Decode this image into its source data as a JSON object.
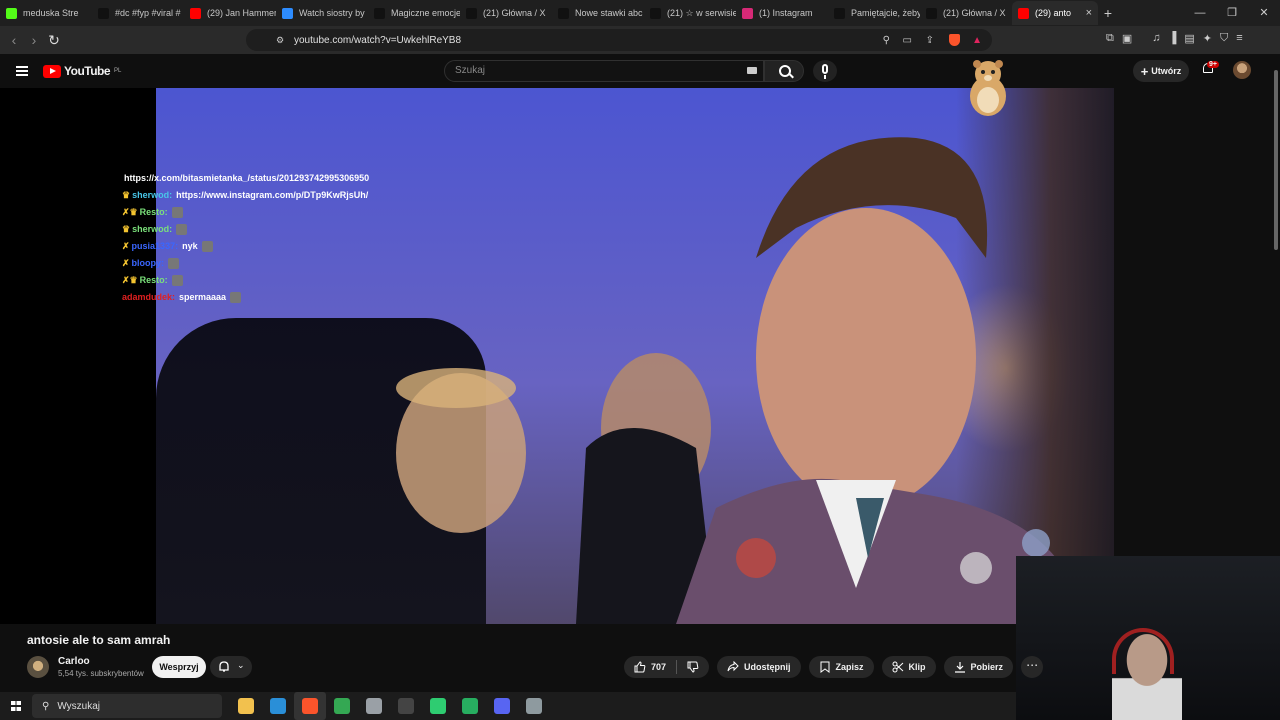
{
  "browser": {
    "tabs": [
      {
        "label": "meduska Stre",
        "icon": "kick-icon",
        "color": "#53fc18"
      },
      {
        "label": "#dc #fyp #viral #",
        "icon": "tiktok-icon",
        "color": "#111111"
      },
      {
        "label": "(29) Jan Hammer",
        "icon": "youtube-icon",
        "color": "#ff0000"
      },
      {
        "label": "Watch siostry by",
        "icon": "watch-icon",
        "color": "#2d8cff"
      },
      {
        "label": "Magiczne emocje",
        "icon": "tiktok-icon",
        "color": "#111111"
      },
      {
        "label": "(21) Główna / X",
        "icon": "x-icon",
        "color": "#111111"
      },
      {
        "label": "Nowe stawki abc",
        "icon": "tiktok-icon",
        "color": "#111111"
      },
      {
        "label": "(21) ☆ w serwisie",
        "icon": "x-icon",
        "color": "#111111"
      },
      {
        "label": "(1) Instagram",
        "icon": "instagram-icon",
        "color": "#d62976"
      },
      {
        "label": "Pamiętajcie, żeby",
        "icon": "tiktok-icon",
        "color": "#111111"
      },
      {
        "label": "(21) Główna / X",
        "icon": "x-icon",
        "color": "#111111"
      },
      {
        "label": "(29) anto",
        "icon": "youtube-icon",
        "color": "#ff0000",
        "active": true
      }
    ],
    "url": "youtube.com/watch?v=UwkehlReYB8"
  },
  "youtube": {
    "logo": "YouTube",
    "region": "PL",
    "search_placeholder": "Szukaj",
    "create_label": "Utwórz",
    "notifications": "9+"
  },
  "chat": [
    {
      "prefix": "",
      "name": "https://x.com/bitasmietanka_/status/201293742995306950",
      "name_color": "white",
      "msg": ""
    },
    {
      "prefix": "♛",
      "name": "sherwod:",
      "name_color": "cyan",
      "msg": "https://www.instagram.com/p/DTp9KwRjsUh/"
    },
    {
      "prefix": "✗♛",
      "name": "Resto:",
      "name_color": "green",
      "msg": ""
    },
    {
      "prefix": "♛",
      "name": "sherwod:",
      "name_color": "green",
      "msg": ""
    },
    {
      "prefix": "✗",
      "name": "pusia1337:",
      "name_color": "blue",
      "msg": "nyk"
    },
    {
      "prefix": "✗",
      "name": "bloopy:",
      "name_color": "blue",
      "msg": ""
    },
    {
      "prefix": "✗♛",
      "name": "Resto:",
      "name_color": "green",
      "msg": ""
    },
    {
      "prefix": "",
      "name": "adamdudek:",
      "name_color": "red",
      "msg": "spermaaaa"
    }
  ],
  "video": {
    "title": "antosie ale to sam amrah",
    "channel": "Carloo",
    "subscribers": "5,54 tys. subskrybentów",
    "join_label": "Wesprzyj",
    "likes": "707",
    "share_label": "Udostępnij",
    "save_label": "Zapisz",
    "clip_label": "Klip",
    "download_label": "Pobierz"
  },
  "taskbar": {
    "search_label": "Wyszukaj",
    "apps": [
      {
        "name": "file-explorer-icon",
        "color": "#f2c14e"
      },
      {
        "name": "edge-icon",
        "color": "#2a8fd8"
      },
      {
        "name": "brave-icon",
        "color": "#fb542b",
        "active": true
      },
      {
        "name": "chrome-icon",
        "color": "#34a853"
      },
      {
        "name": "app-icon",
        "color": "#9aa0a6"
      },
      {
        "name": "obs-icon",
        "color": "#444444"
      },
      {
        "name": "player-icon",
        "color": "#2ecc71"
      },
      {
        "name": "app2-icon",
        "color": "#27ae60"
      },
      {
        "name": "discord-icon",
        "color": "#5865f2"
      },
      {
        "name": "app3-icon",
        "color": "#8e9a9f"
      }
    ]
  }
}
